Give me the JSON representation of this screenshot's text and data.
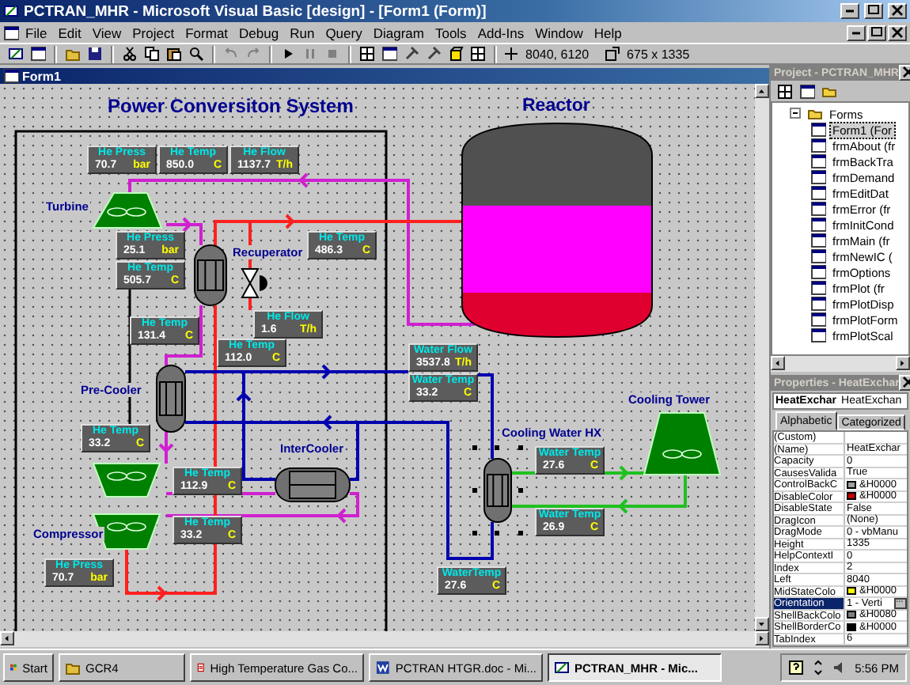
{
  "window": {
    "title": "PCTRAN_MHR - Microsoft Visual Basic [design] - [Form1 (Form)]"
  },
  "menu": [
    "File",
    "Edit",
    "View",
    "Project",
    "Format",
    "Debug",
    "Run",
    "Query",
    "Diagram",
    "Tools",
    "Add-Ins",
    "Window",
    "Help"
  ],
  "toolbar": {
    "position": "8040, 6120",
    "size": "675 x 1335"
  },
  "form": {
    "title": "Form1"
  },
  "diagram": {
    "headings": [
      "Power Conversiton System",
      "Reactor"
    ],
    "labels": [
      "Turbine",
      "Recuperator",
      "Pre-Cooler",
      "InterCooler",
      "Compressor",
      "Cooling Water HX",
      "Cooling Tower"
    ],
    "readouts": [
      {
        "label": "He Press",
        "value": "70.7",
        "unit": "bar"
      },
      {
        "label": "He Temp",
        "value": "850.0",
        "unit": "C"
      },
      {
        "label": "He Flow",
        "value": "1137.7",
        "unit": "T/h"
      },
      {
        "label": "He Press",
        "value": "25.1",
        "unit": "bar"
      },
      {
        "label": "He Temp",
        "value": "505.7",
        "unit": "C"
      },
      {
        "label": "He Temp",
        "value": "486.3",
        "unit": "C"
      },
      {
        "label": "He Temp",
        "value": "131.4",
        "unit": "C"
      },
      {
        "label": "He Flow",
        "value": "1.6",
        "unit": "T/h"
      },
      {
        "label": "He Temp",
        "value": "112.0",
        "unit": "C"
      },
      {
        "label": "Water Flow",
        "value": "3537.8",
        "unit": "T/h"
      },
      {
        "label": "Water Temp",
        "value": "33.2",
        "unit": "C"
      },
      {
        "label": "He Temp",
        "value": "33.2",
        "unit": "C"
      },
      {
        "label": "He Temp",
        "value": "112.9",
        "unit": "C"
      },
      {
        "label": "He Temp",
        "value": "33.2",
        "unit": "C"
      },
      {
        "label": "He Press",
        "value": "70.7",
        "unit": "bar"
      },
      {
        "label": "Water Temp",
        "value": "27.6",
        "unit": "C"
      },
      {
        "label": "Water Temp",
        "value": "26.9",
        "unit": "C"
      },
      {
        "label": "WaterTemp",
        "value": "27.6",
        "unit": "C"
      }
    ]
  },
  "project": {
    "title": "Project - PCTRAN_MHR",
    "folder": "Forms",
    "items": [
      {
        "label": "Form1 (For",
        "selected": true
      },
      {
        "label": "frmAbout (fr",
        "selected": false
      },
      {
        "label": "frmBackTra",
        "selected": false
      },
      {
        "label": "frmDemand",
        "selected": false
      },
      {
        "label": "frmEditDat",
        "selected": false
      },
      {
        "label": "frmError (fr",
        "selected": false
      },
      {
        "label": "frmInitCond",
        "selected": false
      },
      {
        "label": "frmMain (fr",
        "selected": false
      },
      {
        "label": "frmNewIC (",
        "selected": false
      },
      {
        "label": "frmOptions",
        "selected": false
      },
      {
        "label": "frmPlot (fr",
        "selected": false
      },
      {
        "label": "frmPlotDisp",
        "selected": false
      },
      {
        "label": "frmPlotForm",
        "selected": false
      },
      {
        "label": "frmPlotScal",
        "selected": false
      }
    ]
  },
  "properties": {
    "title": "Properties - HeatExchar",
    "object": "HeatExchar",
    "object_type": "HeatExchan",
    "tabs": [
      {
        "label": "Alphabetic",
        "selected": true
      },
      {
        "label": "Categorized",
        "selected": false
      }
    ],
    "rows": [
      {
        "name": "(Custom)",
        "selected": false
      },
      {
        "name": "(Name)",
        "value": "HeatExchar",
        "selected": false
      },
      {
        "name": "Capacity",
        "value": "0",
        "selected": false
      },
      {
        "name": "CausesValida",
        "value": "True",
        "selected": false
      },
      {
        "name": "ControlBackC",
        "value": "&H0000",
        "color": "#a0a0a0",
        "selected": false
      },
      {
        "name": "DisableColor",
        "value": "&H0000",
        "color": "#c00000",
        "selected": false
      },
      {
        "name": "DisableState",
        "value": "False",
        "selected": false
      },
      {
        "name": "DragIcon",
        "value": "(None)",
        "selected": false
      },
      {
        "name": "DragMode",
        "value": "0 - vbManu",
        "selected": false
      },
      {
        "name": "Height",
        "value": "1335",
        "selected": false
      },
      {
        "name": "HelpContextI",
        "value": "0",
        "selected": false
      },
      {
        "name": "Index",
        "value": "2",
        "selected": false
      },
      {
        "name": "Left",
        "value": "8040",
        "selected": false
      },
      {
        "name": "MidStateColo",
        "value": "&H0000",
        "color": "#ffff00",
        "selected": false
      },
      {
        "name": "Orientation",
        "value": "1 - Verti",
        "selected": true
      },
      {
        "name": "ShellBackColo",
        "value": "&H0080",
        "color": "#808080",
        "selected": false
      },
      {
        "name": "ShellBorderCo",
        "value": "&H0000",
        "color": "#000000",
        "selected": false
      },
      {
        "name": "TabIndex",
        "value": "6",
        "selected": false
      }
    ]
  },
  "taskbar": {
    "start": "Start",
    "tasks": [
      {
        "label": "GCR4",
        "selected": false
      },
      {
        "label": "High Temperature Gas Co...",
        "selected": false
      },
      {
        "label": "PCTRAN HTGR.doc - Mi...",
        "selected": false
      },
      {
        "label": "PCTRAN_MHR - Mic...",
        "selected": true
      }
    ],
    "clock": "5:56 PM"
  }
}
